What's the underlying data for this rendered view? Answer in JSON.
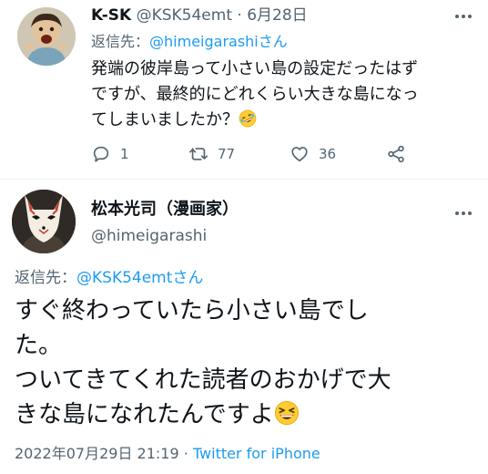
{
  "reply_tweet": {
    "author_name": "K-SK",
    "author_handle": "@KSK54emt",
    "separator": "·",
    "date": "6月28日",
    "replying_to_label": "返信先：",
    "replying_to_handle": "@himeigarashiさん",
    "body_lines": [
      "発端の彼岸島って小さい島の設定だったはず",
      "ですが、最終的にどれくらい大きな島になっ",
      "てしまいましたか？"
    ],
    "body_emoji": "rolling-on-floor-laughing-emoji",
    "actions": {
      "reply_count": "1",
      "retweet_count": "77",
      "like_count": "36"
    }
  },
  "main_tweet": {
    "author_name": "松本光司（漫画家）",
    "author_handle": "@himeigarashi",
    "replying_to_label": "返信先：",
    "replying_to_handle": "@KSK54emtさん",
    "body_lines": [
      "すぐ終わっていたら小さい島でし",
      "た。",
      "ついてきてくれた読者のおかげで大",
      "きな島になれたんですよ"
    ],
    "body_emoji": "grinning-squinting-face-emoji",
    "timestamp": "2022年07月29日 21:19",
    "separator": "·",
    "source": "Twitter for iPhone"
  },
  "colors": {
    "text_primary": "#0f1419",
    "text_secondary": "#536471",
    "link": "#1d9bf0",
    "divider": "#eff3f4"
  }
}
